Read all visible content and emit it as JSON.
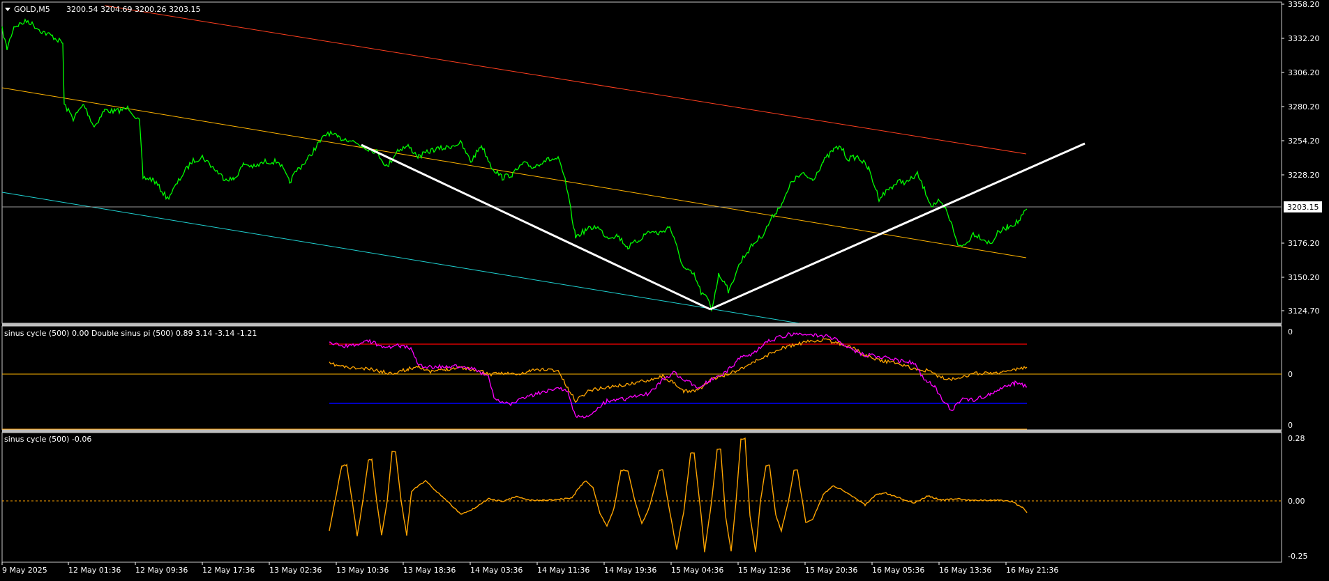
{
  "main": {
    "header": {
      "symbol": "GOLD,M5",
      "ohlc": "3200.54 3204.69 3200.26 3203.15"
    },
    "price_scale": [
      "3358.20",
      "3332.20",
      "3306.20",
      "3280.20",
      "3254.20",
      "3228.20",
      "3203.15",
      "3176.20",
      "3150.20",
      "3124.70"
    ],
    "current_price": "3203.15",
    "colors": {
      "price": "#00ff00",
      "upper_channel": "#ff3f1f",
      "middle_channel": "#ffb400",
      "lower_channel": "#1fd1d1",
      "trend_lines": "#ffffff"
    }
  },
  "indicator1": {
    "label": "sinus cycle (500) 0.00  Double sinus pi (500) 0.89 3.14 -3.14 -1.21",
    "scale": [
      "0",
      "0",
      "0"
    ],
    "colors": {
      "magenta": "#ff00ff",
      "orange": "#ffa500",
      "upper_level": "#ff0000",
      "lower_level": "#0000ff",
      "zero_level": "#ffb400"
    }
  },
  "indicator2": {
    "label": "sinus cycle (500) -0.06",
    "scale": [
      "0.28",
      "0.00",
      "-0.25"
    ],
    "colors": {
      "line": "#ffa500",
      "zero": "#ffa500"
    }
  },
  "time_axis": [
    "9 May 2025",
    "12 May 01:36",
    "12 May 09:36",
    "12 May 17:36",
    "13 May 02:36",
    "13 May 10:36",
    "13 May 18:36",
    "14 May 03:36",
    "14 May 11:36",
    "14 May 19:36",
    "15 May 04:36",
    "15 May 12:36",
    "15 May 20:36",
    "16 May 05:36",
    "16 May 13:36",
    "16 May 21:36"
  ]
}
